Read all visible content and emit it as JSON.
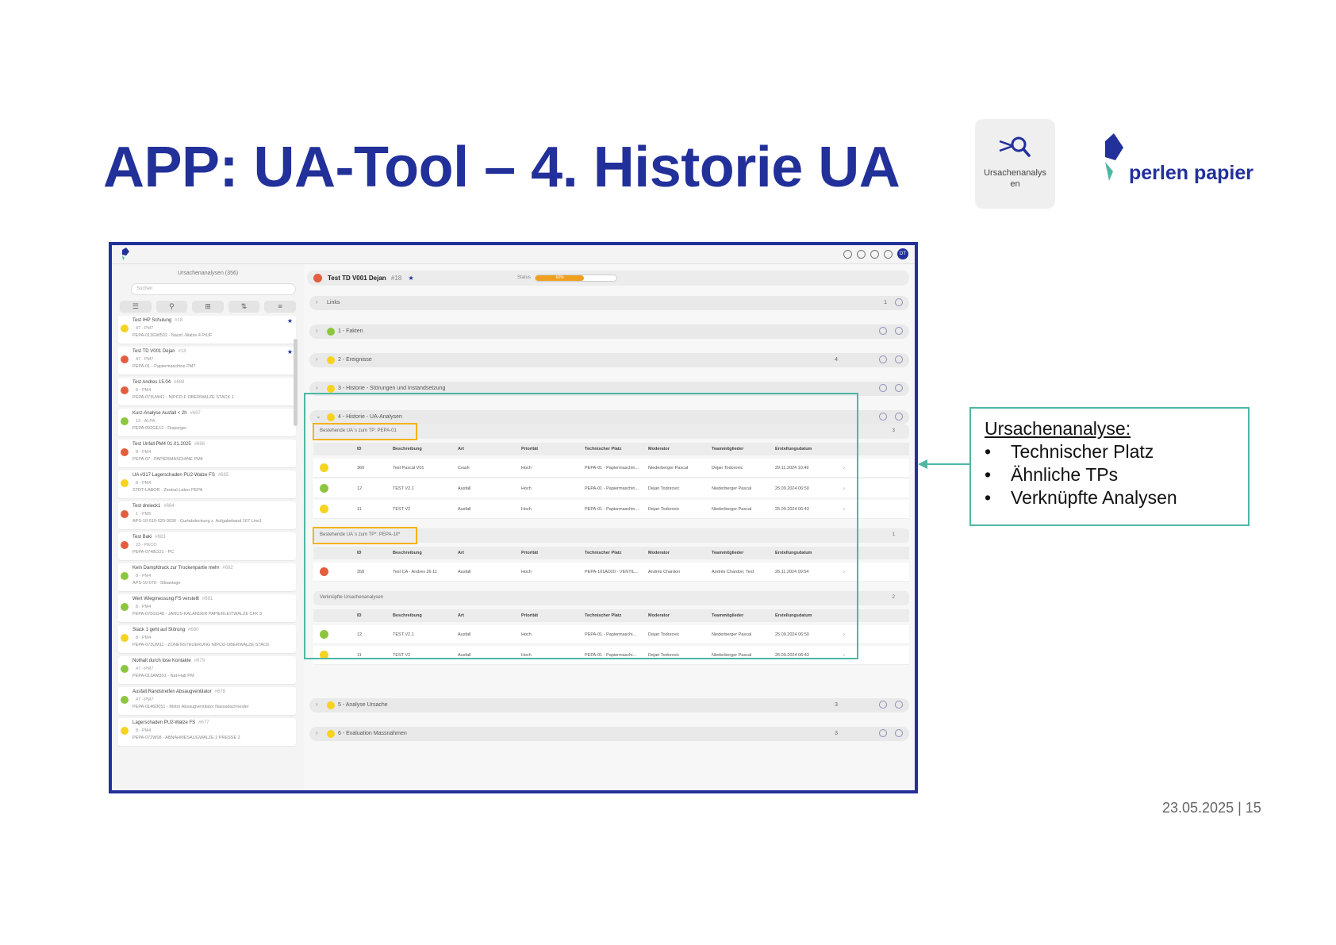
{
  "slide": {
    "title": "APP: UA-Tool – 4. Historie UA",
    "app_icon_label_1": "Ursachenanalys",
    "app_icon_label_2": "en",
    "logo_text": "perlen papier",
    "footer": "23.05.2025 | 15"
  },
  "callout": {
    "title": "Ursachenanalyse:",
    "items": [
      "Technischer Platz",
      "Ähnliche TPs",
      "Verknüpfte Analysen"
    ]
  },
  "colors": {
    "brand": "#22309a",
    "highlight": "#f3b21c",
    "callout_border": "#4db7a4",
    "red": "#e35e3e",
    "yellow": "#f5d320",
    "green": "#8cc63e",
    "progress": "#f0a020"
  },
  "app": {
    "list_header": "Ursachenanalysen (356)",
    "search_placeholder": "Suchen",
    "list": [
      {
        "status": "yellow",
        "title": "Test IHP Schulung",
        "num": "#18",
        "line2": "47 - PM7",
        "line3": "PEPA-013GW502 - Nassf.-Walze 4 PrUF",
        "star": true
      },
      {
        "status": "red",
        "title": "Test TD V001 Dejan",
        "num": "#18",
        "line2": "47 - PM7",
        "line3": "PEPA-01 - Papiermaschine PM7",
        "star": true
      },
      {
        "status": "red",
        "title": "Test Andres 15.04",
        "num": "#688",
        "line2": "8 - PM4",
        "line3": "PEPA-073UW41 - NIPCO-F OBERWALZE STACK 1",
        "star": false
      },
      {
        "status": "green",
        "title": "Kurz-Analyse Ausfall < 2h",
        "num": "#687",
        "line2": "13 - ALPA",
        "line3": "PEPA-092GE12 - Disperger",
        "star": false
      },
      {
        "status": "red",
        "title": "Test Unfall PM4 01.01.2025",
        "num": "#686",
        "line2": "8 - PM4",
        "line3": "PEPA-07 - PAPIERMASCHINE PM4",
        "star": false
      },
      {
        "status": "yellow",
        "title": "UA #317 Lagerschaden PU2-Walze FS",
        "num": "#685",
        "line2": "8 - PM4",
        "line3": "STDT-LABOR - Zentral-Labor PEPA",
        "star": false
      },
      {
        "status": "red",
        "title": "Test dreieck1",
        "num": "#684",
        "line2": "1 - PM5",
        "line3": "APS-10-010-020-0036 - Gurtabdeckung z. Aufgabeband 167 Line1",
        "star": false
      },
      {
        "status": "red",
        "title": "Test Baki",
        "num": "#683",
        "line2": "23 - PECO",
        "line3": "PEPA-0748CO1 - PC",
        "star": false
      },
      {
        "status": "green",
        "title": "Kein Dampfdruck zur Trockenpartie mehr",
        "num": "#682",
        "line2": "8 - PM4",
        "line3": "APS-10-070 - Siloanlage",
        "star": false
      },
      {
        "status": "green",
        "title": "Wert Wiegmessung FS verstellt",
        "num": "#681",
        "line2": "8 - PM4",
        "line3": "PEPA-075GG48 - JANUS-KALANDER PAPIERLEITWALZE CFK 3",
        "star": false
      },
      {
        "status": "yellow",
        "title": "Stack 1 geht auf Störung",
        "num": "#680",
        "line2": "8 - PM4",
        "line3": "PEPA-073UM11 - ZONENSTEUERUNG NIPCO-OBERWALZE STACK",
        "star": false
      },
      {
        "status": "green",
        "title": "Nothalt durch lose Kontakte",
        "num": "#679",
        "line2": "47 - PM7",
        "line3": "PEPA-013AM301 - Nat-Halt PM",
        "star": false
      },
      {
        "status": "green",
        "title": "Ausfall Randstreifen Absaugventilator",
        "num": "#678",
        "line2": "47 - PM7",
        "line3": "PEPA-0146D051 - Motor Absaugventilator Nassabschneider",
        "star": false
      },
      {
        "status": "yellow",
        "title": "Lagerschaden PU2-Walze FS",
        "num": "#677",
        "line2": "8 - PM4",
        "line3": "PEPA-072W08 - ABNAHMESAUGWALZE 2 PRESSE 2",
        "star": false
      }
    ],
    "header": {
      "title": "Test TD V001 Dejan",
      "num": "#18",
      "status_label": "Status",
      "progress_text": "60%",
      "progress": 0.6
    },
    "sections": [
      {
        "label": "Links",
        "count": "1"
      },
      {
        "label": "1 - Fakten",
        "status": "green"
      },
      {
        "label": "2 - Ereignisse",
        "status": "yellow",
        "count": "4"
      },
      {
        "label": "3 - Historie - Störungen und Instandsetzung",
        "status": "yellow"
      },
      {
        "label": "4 - Historie - UA-Analysen",
        "status": "yellow"
      },
      {
        "label": "5 - Analyse Ursache",
        "status": "yellow",
        "count": "3"
      },
      {
        "label": "6 - Evaluation Massnahmen",
        "status": "yellow",
        "count": "3"
      }
    ],
    "columns": [
      "ID",
      "Beschreibung",
      "Art",
      "Priorität",
      "Technischer Platz",
      "Moderator",
      "Teammitglieder",
      "Erstellungsdatum"
    ],
    "group1": {
      "label": "Bestehende UA´s zum TP: PEPA-01",
      "count": "3",
      "rows": [
        {
          "status": "yellow",
          "id": "360",
          "desc": "Test Pascal V01",
          "art": "Crash",
          "prio": "Hoch",
          "tp": "PEPA-01 - Papiermaschin...",
          "mod": "Niederberger Pascal",
          "team": "Dejan Todorovic",
          "date": "29.11.2024 10:49"
        },
        {
          "status": "green",
          "id": "12",
          "desc": "TEST V2.1",
          "art": "Ausfall",
          "prio": "Hoch",
          "tp": "PEPA-01 - Papiermaschin...",
          "mod": "Dejan Todorovic",
          "team": "Niederberger Pascal",
          "date": "25.09.2024 06:50"
        },
        {
          "status": "yellow",
          "id": "11",
          "desc": "TEST V2",
          "art": "Ausfall",
          "prio": "Hoch",
          "tp": "PEPA-01 - Papiermaschin...",
          "mod": "Dejan Todorovic",
          "team": "Niederberger Pascal",
          "date": "25.09.2024 06:43"
        }
      ]
    },
    "group2": {
      "label": "Bestehende UA´s zum TP*: PEPA-10*",
      "count": "1",
      "rows": [
        {
          "status": "red",
          "id": "358",
          "desc": "Test CA - Andres 26.11",
          "art": "Ausfall",
          "prio": "Hoch",
          "tp": "PEPA-101AD20 - VENTIL...",
          "mod": "Andrés Chardon",
          "team": "Andrés Chardon; Test",
          "date": "26.11.2024 09:54"
        }
      ]
    },
    "group3": {
      "label": "Verknüpfte Ursachenanalysen",
      "count": "2",
      "rows": [
        {
          "status": "green",
          "id": "12",
          "desc": "TEST V2.1",
          "art": "Ausfall",
          "prio": "Hoch",
          "tp": "PEPA-01 - Papiermaschi...",
          "mod": "Dejan Todorovic",
          "team": "Niederberger Pascal",
          "date": "25.09.2024 06:50"
        },
        {
          "status": "yellow",
          "id": "11",
          "desc": "TEST V2",
          "art": "Ausfall",
          "prio": "Hoch",
          "tp": "PEPA-01 - Papiermaschi...",
          "mod": "Dejan Todorovic",
          "team": "Niederberger Pascal",
          "date": "25.09.2024 06:43"
        }
      ]
    }
  }
}
